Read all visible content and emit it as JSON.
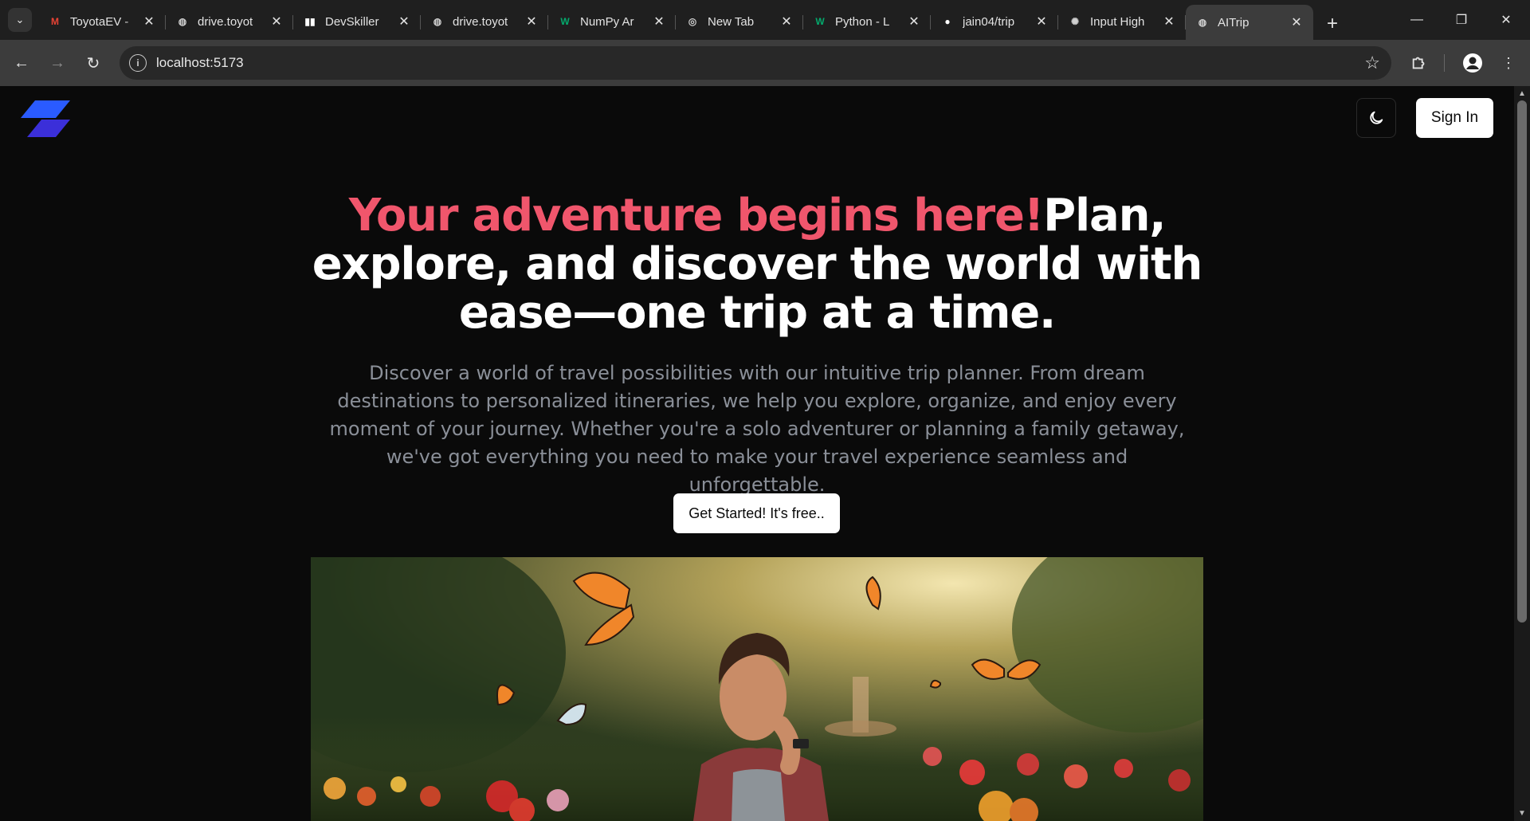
{
  "browser": {
    "tabs": [
      {
        "title": "ToyotaEV -",
        "icon": "gmail-icon",
        "fav": "M",
        "fav_color": "#ea4335"
      },
      {
        "title": "drive.toyot",
        "icon": "globe-icon",
        "fav": "◍",
        "fav_color": "#cfcfcf"
      },
      {
        "title": "DevSkiller",
        "icon": "devskiller-icon",
        "fav": "▮▮",
        "fav_color": "#ffffff"
      },
      {
        "title": "drive.toyot",
        "icon": "globe-icon",
        "fav": "◍",
        "fav_color": "#cfcfcf"
      },
      {
        "title": "NumPy Ar",
        "icon": "w3schools-icon",
        "fav": "W",
        "fav_color": "#04aa6d"
      },
      {
        "title": "New Tab",
        "icon": "chrome-icon",
        "fav": "◎",
        "fav_color": "#cfcfcf"
      },
      {
        "title": "Python - L",
        "icon": "w3schools-icon",
        "fav": "W",
        "fav_color": "#04aa6d"
      },
      {
        "title": "jain04/trip",
        "icon": "github-icon",
        "fav": "●",
        "fav_color": "#ffffff"
      },
      {
        "title": "Input High",
        "icon": "openai-icon",
        "fav": "✺",
        "fav_color": "#cfcfcf"
      },
      {
        "title": "AITrip",
        "icon": "globe-icon",
        "fav": "◍",
        "fav_color": "#cfcfcf",
        "active": true
      }
    ],
    "address": "localhost:5173"
  },
  "header": {
    "sign_in_label": "Sign In",
    "theme_toggle_icon": "moon-icon"
  },
  "hero": {
    "headline_accent": "Your adventure begins here!",
    "headline_rest": "Plan, explore, and discover the world with ease—one trip at a time.",
    "description": "Discover a world of travel possibilities with our intuitive trip planner. From dream destinations to personalized itineraries, we help you explore, organize, and enjoy every moment of your journey. Whether you're a solo adventurer or planning a family getaway, we've got everything you need to make your travel experience seamless and unforgettable.",
    "cta_label": "Get Started! It's free.."
  },
  "colors": {
    "accent": "#f0566c",
    "background": "#0a0a0a",
    "logo_primary": "#2a5bff",
    "logo_secondary": "#3b2fd9"
  }
}
